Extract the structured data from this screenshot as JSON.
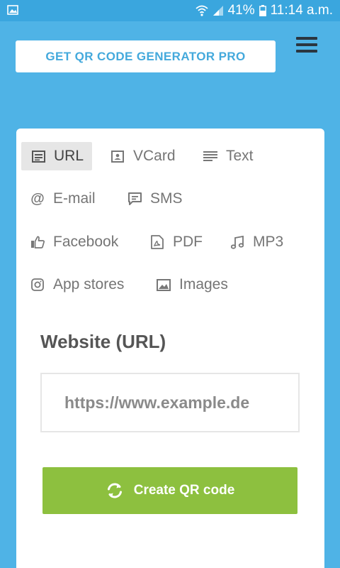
{
  "status_bar": {
    "battery": "41%",
    "time": "11:14 a.m."
  },
  "header": {
    "pro_button": "GET QR CODE GENERATOR PRO",
    "menu_icon": "hamburger-icon"
  },
  "tabs": [
    {
      "label": "URL",
      "icon": "document-icon"
    },
    {
      "label": "VCard",
      "icon": "contact-card-icon"
    },
    {
      "label": "Text",
      "icon": "text-lines-icon"
    },
    {
      "label": "E-mail",
      "icon": "at-icon"
    },
    {
      "label": "SMS",
      "icon": "chat-icon"
    },
    {
      "label": "Facebook",
      "icon": "thumbs-up-icon"
    },
    {
      "label": "PDF",
      "icon": "pdf-icon"
    },
    {
      "label": "MP3",
      "icon": "music-note-icon"
    },
    {
      "label": "App stores",
      "icon": "instagram-icon"
    },
    {
      "label": "Images",
      "icon": "image-icon"
    }
  ],
  "form": {
    "label": "Website (URL)",
    "placeholder": "https://www.example.de",
    "value": "",
    "submit_label": "Create QR code",
    "submit_icon": "refresh-icon"
  },
  "colors": {
    "background": "#4fb3e6",
    "accent": "#44a9dc",
    "submit": "#8dc03f"
  }
}
